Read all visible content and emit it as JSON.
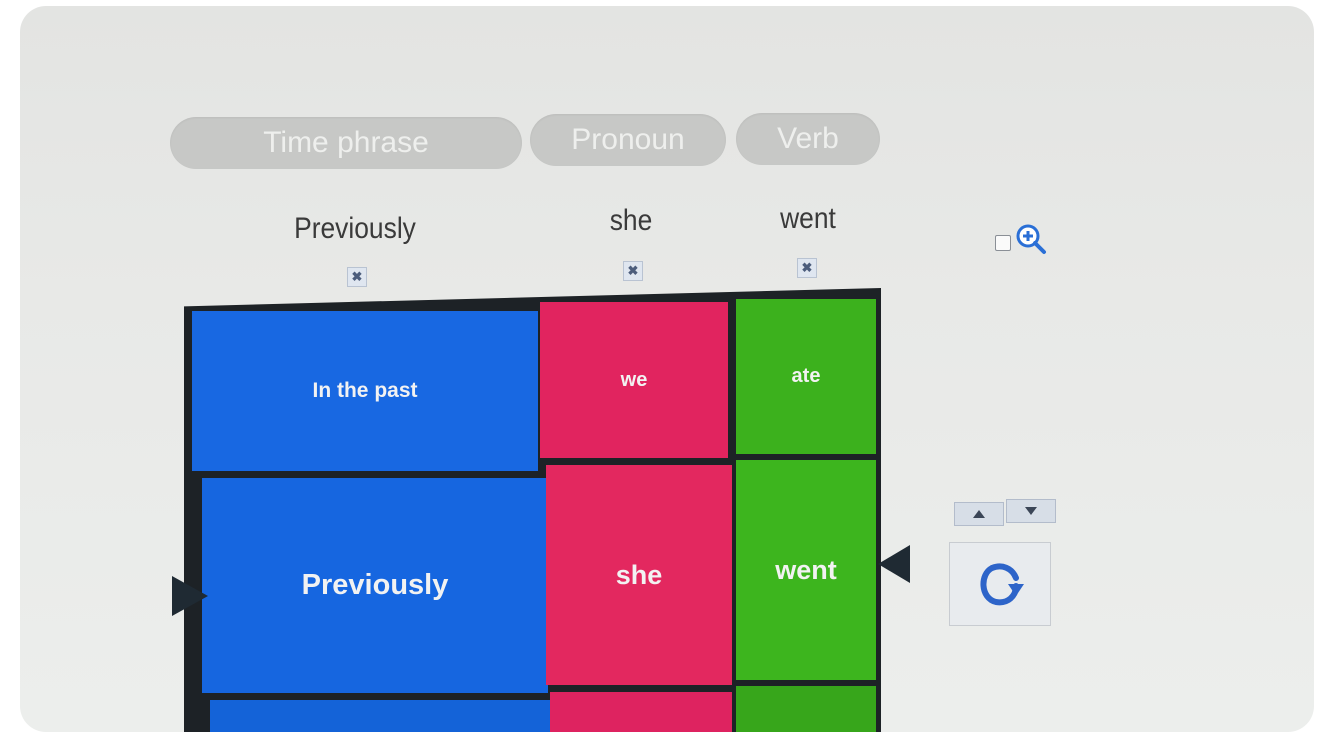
{
  "headers": [
    {
      "label": "Time phrase"
    },
    {
      "label": "Pronoun"
    },
    {
      "label": "Verb"
    }
  ],
  "selected": [
    {
      "word": "Previously",
      "remove_icon": "close-icon"
    },
    {
      "word": "she",
      "remove_icon": "close-icon"
    },
    {
      "word": "went",
      "remove_icon": "close-icon"
    }
  ],
  "reels": [
    {
      "color": "#1565e0",
      "tiles": [
        "In the past",
        "Previously",
        ""
      ]
    },
    {
      "color": "#e3265f",
      "tiles": [
        "we",
        "she",
        ""
      ]
    },
    {
      "color": "#3ab21c",
      "tiles": [
        "ate",
        "went",
        ""
      ]
    }
  ],
  "controls": {
    "zoom_icon": "zoom-in-icon",
    "checkbox_checked": false,
    "up_icon": "up-arrow-icon",
    "down_icon": "down-arrow-icon",
    "spin_icon": "rotate-icon"
  }
}
